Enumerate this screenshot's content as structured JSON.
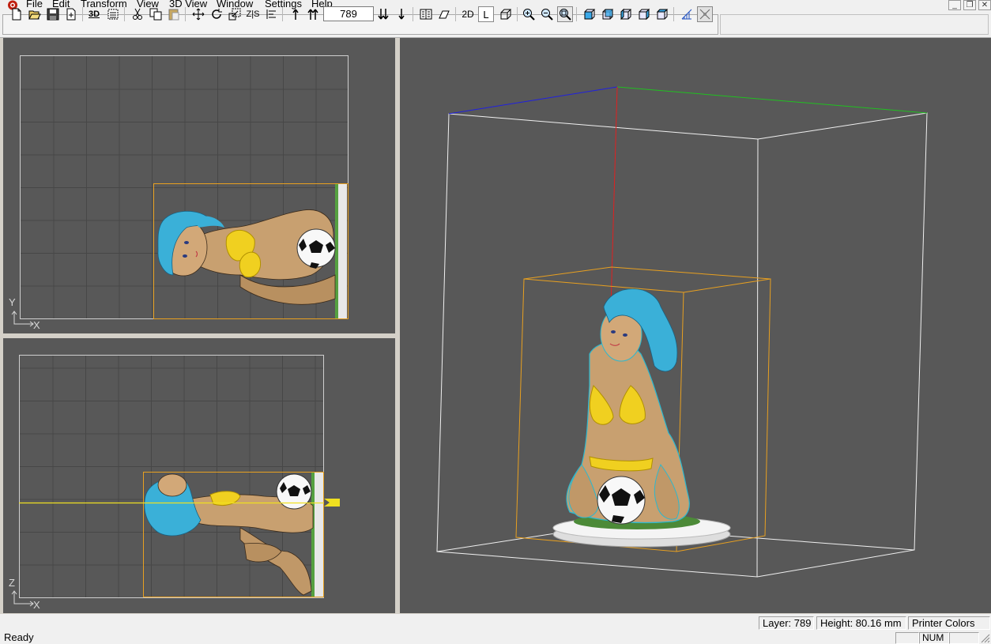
{
  "menu": {
    "items": [
      "File",
      "Edit",
      "Transform",
      "View",
      "3D View",
      "Window",
      "Settings",
      "Help"
    ]
  },
  "window_buttons": [
    "minimize",
    "restore",
    "close"
  ],
  "toolbar": {
    "groups": [
      [
        "new-icon",
        "open-icon",
        "save-icon",
        "export-icon"
      ],
      [
        "3d-slice-icon",
        "slice-settings-icon"
      ],
      [
        "cut-icon",
        "copy-icon",
        "paste-icon"
      ],
      [
        "move-icon",
        "rotate-icon",
        "scale-icon",
        "mirror-icon",
        "align-icon"
      ],
      [
        "layer-up-icon",
        "layer-top-icon"
      ],
      [
        "layer-bottom-icon",
        "layer-down-icon"
      ],
      [
        "slice-list-icon",
        "slice-view-icon"
      ],
      [
        "2d-view",
        "layer-view",
        "3d-box-view"
      ],
      [
        "zoom-in-icon",
        "zoom-out-icon",
        "zoom-fit-icon"
      ],
      [
        "front-view-icon",
        "back-view-icon",
        "left-view-icon",
        "right-view-icon",
        "top-view-icon"
      ],
      [
        "support-icon",
        "clear-support-icon"
      ]
    ],
    "layer_value": "789",
    "view_2d_label": "2D",
    "view_layer_label": "L",
    "slice_3d_label": "3D",
    "zlabel": "Z|S"
  },
  "viewports": {
    "top": {
      "axis_y": "Y",
      "axis_x": "X"
    },
    "side": {
      "axis_z": "Z",
      "axis_x": "X"
    }
  },
  "status": {
    "ready": "Ready",
    "layer": "Layer: 789",
    "height": "Height: 80.16 mm",
    "color_mode": "Printer Colors",
    "num": "NUM"
  },
  "colors": {
    "viewport_bg": "#585858",
    "bounding_box": "#e8a020",
    "axis_red": "#e02020",
    "axis_green": "#20c020",
    "axis_blue": "#2020e0",
    "slice_plane": "#f0e020"
  }
}
